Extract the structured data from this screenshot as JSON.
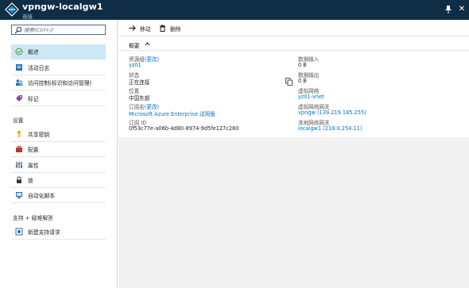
{
  "window": {
    "title": "vpngw-localgw1",
    "subtitle": "连接"
  },
  "sidebar": {
    "search_placeholder": "搜索(Ctrl+/)",
    "items": [
      {
        "label": "概述",
        "icon": "overview-icon",
        "active": true
      },
      {
        "label": "活动日志",
        "icon": "activity-log-icon"
      },
      {
        "label": "访问控制(标识和访问管理)",
        "icon": "access-control-icon"
      },
      {
        "label": "标记",
        "icon": "tag-icon"
      }
    ],
    "settings_header": "设置",
    "settings_items": [
      {
        "label": "共享密钥",
        "icon": "key-icon"
      },
      {
        "label": "配置",
        "icon": "config-icon"
      },
      {
        "label": "属性",
        "icon": "properties-icon"
      },
      {
        "label": "锁",
        "icon": "lock-icon"
      },
      {
        "label": "自动化脚本",
        "icon": "automation-icon"
      }
    ],
    "support_header": "支持 + 疑难解答",
    "support_items": [
      {
        "label": "新建支持请求",
        "icon": "support-icon"
      }
    ]
  },
  "toolbar": {
    "move_label": "移动",
    "delete_label": "删除"
  },
  "essentials": {
    "header": "概要",
    "left": {
      "resource_group_label": "资源组",
      "resource_group_change": "(更改)",
      "resource_group_value": "yz01",
      "status_label": "状态",
      "status_value": "正在连接",
      "location_label": "位置",
      "location_value": "中国东部",
      "subscription_label": "订阅名",
      "subscription_change": "(更改)",
      "subscription_value": "Microsoft Azure Enterprise 试用版",
      "subscription_id_label": "订阅 ID",
      "subscription_id_value": "0f53c77e-a06b-4d80-8974-9d5fe127c280"
    },
    "right": {
      "data_in_label": "数据输入",
      "data_in_value": "0 B",
      "data_out_label": "数据输出",
      "data_out_value": "0 B",
      "vnet_label": "虚拟网络",
      "vnet_value": "yz01-vnet",
      "vng_label": "虚拟网络网关",
      "vng_value": "vpngw (139.219.185.255)",
      "lng_label": "本地网络网关",
      "lng_value": "localgw1 (218.0.254.11)"
    }
  }
}
